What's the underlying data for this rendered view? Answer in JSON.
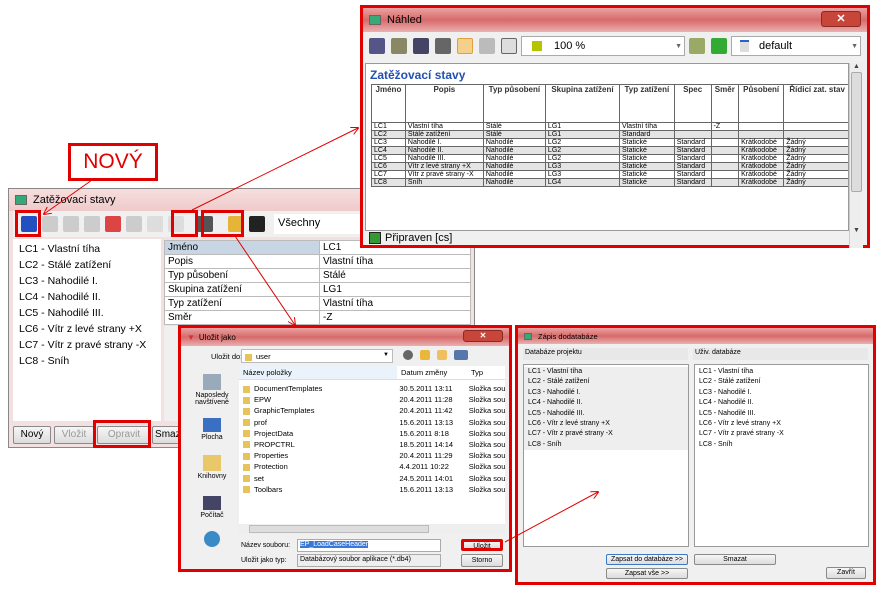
{
  "annotation": {
    "label": "NOVÝ",
    "accent": "#e00000"
  },
  "preview": {
    "title": "Náhled",
    "zoom": "100 %",
    "style": "default",
    "heading": "Zatěžovací stavy",
    "status": "Připraven [cs]",
    "columns": [
      "Jméno",
      "Popis",
      "Typ působení",
      "Skupina zatížení",
      "Typ zatížení",
      "Spec",
      "Směr",
      "Působení",
      "Řídicí zat. stav"
    ],
    "rows": [
      [
        "LC1",
        "Vlastní tíha",
        "Stálé",
        "LG1",
        "Vlastní tíha",
        "",
        "-Z",
        "",
        ""
      ],
      [
        "LC2",
        "Stálé zatížení",
        "Stálé",
        "LG1",
        "Standard",
        "",
        "",
        "",
        ""
      ],
      [
        "LC3",
        "Nahodilé I.",
        "Nahodilé",
        "LG2",
        "Statické",
        "Standard",
        "",
        "Krátkodobé",
        "Žádný"
      ],
      [
        "LC4",
        "Nahodilé II.",
        "Nahodilé",
        "LG2",
        "Statické",
        "Standard",
        "",
        "Krátkodobé",
        "Žádný"
      ],
      [
        "LC5",
        "Nahodilé III.",
        "Nahodilé",
        "LG2",
        "Statické",
        "Standard",
        "",
        "Krátkodobé",
        "Žádný"
      ],
      [
        "LC6",
        "Vítr z levé strany +X",
        "Nahodilé",
        "LG3",
        "Statické",
        "Standard",
        "",
        "Krátkodobé",
        "Žádný"
      ],
      [
        "LC7",
        "Vítr z pravé strany -X",
        "Nahodilé",
        "LG3",
        "Statické",
        "Standard",
        "",
        "Krátkodobé",
        "Žádný"
      ],
      [
        "LC8",
        "Sníh",
        "Nahodilé",
        "LG4",
        "Statické",
        "Standard",
        "",
        "Krátkodobé",
        "Žádný"
      ]
    ]
  },
  "main": {
    "title": "Zatěžovací stavy",
    "filter": "Všechny",
    "items": [
      "LC1 - Vlastní tíha",
      "LC2 - Stálé zatížení",
      "LC3 - Nahodilé I.",
      "LC4 - Nahodilé II.",
      "LC5 - Nahodilé III.",
      "LC6 - Vítr z levé strany +X",
      "LC7 - Vítr z pravé strany -X",
      "LC8 - Sníh"
    ],
    "props": [
      [
        "Jméno",
        "LC1"
      ],
      [
        "Popis",
        "Vlastní tíha"
      ],
      [
        "Typ působení",
        "Stálé"
      ],
      [
        "Skupina zatížení",
        "LG1"
      ],
      [
        "Typ zatížení",
        "Vlastní tíha"
      ],
      [
        "Směr",
        "-Z"
      ]
    ],
    "buttons": {
      "new": "Nový",
      "insert": "Vložit",
      "edit": "Opravit",
      "delete": "Smazat"
    }
  },
  "save": {
    "title": "Uložit jako",
    "save_in_label": "Uložit do:",
    "folder": "user",
    "places": [
      "Naposledy navštívené",
      "Plocha",
      "Knihovny",
      "Počítač"
    ],
    "columns": [
      "Název položky",
      "Datum změny",
      "Typ"
    ],
    "files": [
      [
        "DocumentTemplates",
        "30.5.2011 13:11",
        "Složka sou"
      ],
      [
        "EPW",
        "20.4.2011 11:28",
        "Složka sou"
      ],
      [
        "GraphicTemplates",
        "20.4.2011 11:42",
        "Složka sou"
      ],
      [
        "prof",
        "15.6.2011 13:13",
        "Složka sou"
      ],
      [
        "ProjectData",
        "15.6.2011 8:18",
        "Složka sou"
      ],
      [
        "PROPCTRL",
        "18.5.2011 14:14",
        "Složka sou"
      ],
      [
        "Properties",
        "20.4.2011 11:29",
        "Složka sou"
      ],
      [
        "Protection",
        "4.4.2011 10:22",
        "Složka sou"
      ],
      [
        "set",
        "24.5.2011 14:01",
        "Složka sou"
      ],
      [
        "Toolbars",
        "15.6.2011 13:13",
        "Složka sou"
      ]
    ],
    "filename_label": "Název souboru:",
    "filename": "EP_LoadCaseHeader",
    "type_label": "Uložit jako typ:",
    "type": "Databázový soubor aplikace (*.db4)",
    "save_btn": "Uložit",
    "cancel_btn": "Storno"
  },
  "db": {
    "title": "Zápis dodatabáze",
    "left_label": "Databáze projektu",
    "right_label": "Uživ. databáze",
    "left": [
      "LC1 - Vlastní tíha",
      "LC2 - Stálé zatížení",
      "LC3 - Nahodilé I.",
      "LC4 - Nahodilé II.",
      "LC5 - Nahodilé III.",
      "LC6 - Vítr z levé strany +X",
      "LC7 - Vítr z pravé strany -X",
      "LC8 - Sníh"
    ],
    "right": [
      "LC1 - Vlastní tíha",
      "LC2 - Stálé zatížení",
      "LC3 - Nahodilé I.",
      "LC4 - Nahodilé II.",
      "LC5 - Nahodilé III.",
      "LC6 - Vítr z levé strany +X",
      "LC7 - Vítr z pravé strany -X",
      "LC8 - Sníh"
    ],
    "write_btn": "Zapsat do databáze >>",
    "write_all_btn": "Zapsat vše >>",
    "delete_btn": "Smazat",
    "close_btn": "Zavřít"
  }
}
